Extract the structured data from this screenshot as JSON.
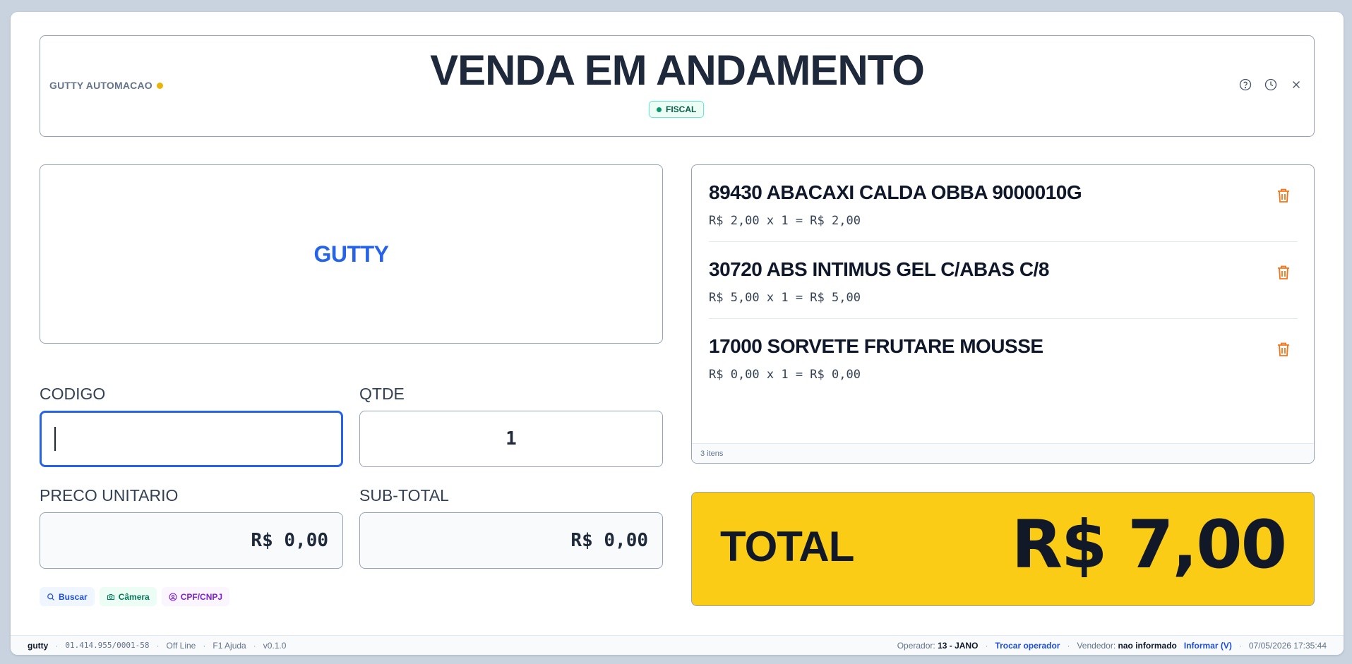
{
  "header": {
    "company": "GUTTY AUTOMACAO",
    "title": "VENDA EM ANDAMENTO",
    "badge": "FISCAL",
    "icons": [
      "help-icon",
      "history-icon",
      "close-icon"
    ]
  },
  "logo": {
    "text": "GUTTY"
  },
  "fields": {
    "codigo": {
      "label": "CODIGO",
      "value": ""
    },
    "qtde": {
      "label": "QTDE",
      "value": "1"
    },
    "preco_unitario": {
      "label": "PRECO UNITARIO",
      "value": "R$ 0,00"
    },
    "sub_total": {
      "label": "SUB-TOTAL",
      "value": "R$ 0,00"
    }
  },
  "quick_actions": {
    "buscar": "Buscar",
    "camera": "Câmera",
    "cpf": "CPF/CNPJ"
  },
  "items": [
    {
      "name": "89430 ABACAXI CALDA OBBA 9000010G",
      "calc": "R$ 2,00 x 1 = R$ 2,00"
    },
    {
      "name": "30720 ABS INTIMUS GEL C/ABAS C/8",
      "calc": "R$ 5,00 x 1 = R$ 5,00"
    },
    {
      "name": "17000 SORVETE FRUTARE MOUSSE",
      "calc": "R$ 0,00 x 1 = R$ 0,00"
    }
  ],
  "items_count": "3 itens",
  "total": {
    "label": "TOTAL",
    "value": "R$ 7,00"
  },
  "statusbar": {
    "user": "gutty",
    "cnpj": "01.414.955/0001-58",
    "connection": "Off Line",
    "help": "F1 Ajuda",
    "version": "v0.1.0",
    "operator_label": "Operador:",
    "operator_value": "13 - JANO",
    "change_operator": "Trocar operador",
    "seller_label": "Vendedor:",
    "seller_value": "nao informado",
    "inform_seller": "Informar (V)",
    "datetime": "07/05/2026 17:35:44"
  },
  "colors": {
    "accent": "#2563eb",
    "total_bg": "#facc15",
    "trash": "#f97316",
    "status_dot": "#eab308"
  }
}
